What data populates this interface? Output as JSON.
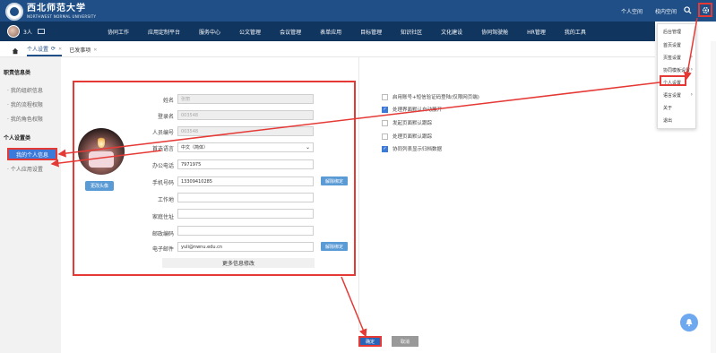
{
  "header": {
    "logo_cn": "西北师范大学",
    "logo_en": "NORTHWEST NORMAL UNIVERSITY",
    "links": [
      "个人空间",
      "校内空间"
    ]
  },
  "navbar": {
    "user_count": "3人",
    "menu": [
      "协同工作",
      "应用定制平台",
      "服务中心",
      "公文管理",
      "会议管理",
      "表单应用",
      "目标管理",
      "知识社区",
      "文化建设",
      "协同驾驶舱",
      "HR管理",
      "我的工具"
    ]
  },
  "tabs": [
    {
      "label": "个人设置"
    },
    {
      "label": "已发事项"
    }
  ],
  "sidebar": {
    "section1_title": "职责信息类",
    "section1_items": [
      "· 我的组织信息",
      "· 我的流程权限",
      "· 我的角色权限"
    ],
    "section2_title": "个人设置类",
    "active_item": "我的个人信息",
    "section2_items": [
      "· 个人应用设置"
    ]
  },
  "form": {
    "change_photo": "更改头像",
    "rows": [
      {
        "label": "姓名",
        "value": "张丽"
      },
      {
        "label": "登录名",
        "value": "003548"
      },
      {
        "label": "人员编号",
        "value": "003548"
      },
      {
        "label": "首选语言",
        "value": "中文（简体）"
      },
      {
        "label": "办公电话",
        "value": "7971975"
      },
      {
        "label": "手机号码",
        "value": "13309410285"
      },
      {
        "label": "工作地",
        "value": ""
      },
      {
        "label": "家庭住址",
        "value": ""
      },
      {
        "label": "邮政编码",
        "value": ""
      },
      {
        "label": "电子邮件",
        "value": "yuli@nwnu.edu.cn"
      }
    ],
    "unbind": "解除绑定",
    "more_info": "更多信息修改"
  },
  "options": [
    {
      "label": "启用账号+短信验证码登陆(仅限网页端)",
      "checked": false
    },
    {
      "label": "处理界面默认自动展开",
      "checked": true
    },
    {
      "label": "发起页面默认跟踪",
      "checked": false
    },
    {
      "label": "处理页面默认跟踪",
      "checked": false
    },
    {
      "label": "协同列表显示归档数据",
      "checked": true
    }
  ],
  "buttons": {
    "confirm": "确定",
    "cancel": "取消"
  },
  "dropdown": [
    "后台管理",
    "首页设置",
    "页签设置",
    "协同模板设置",
    "个人设置",
    "语言设置",
    "关于",
    "退出"
  ],
  "colors": {
    "header": "#1f4f86",
    "nav": "#10355f",
    "accent": "#3b7ad8",
    "highlight": "#e53935"
  }
}
